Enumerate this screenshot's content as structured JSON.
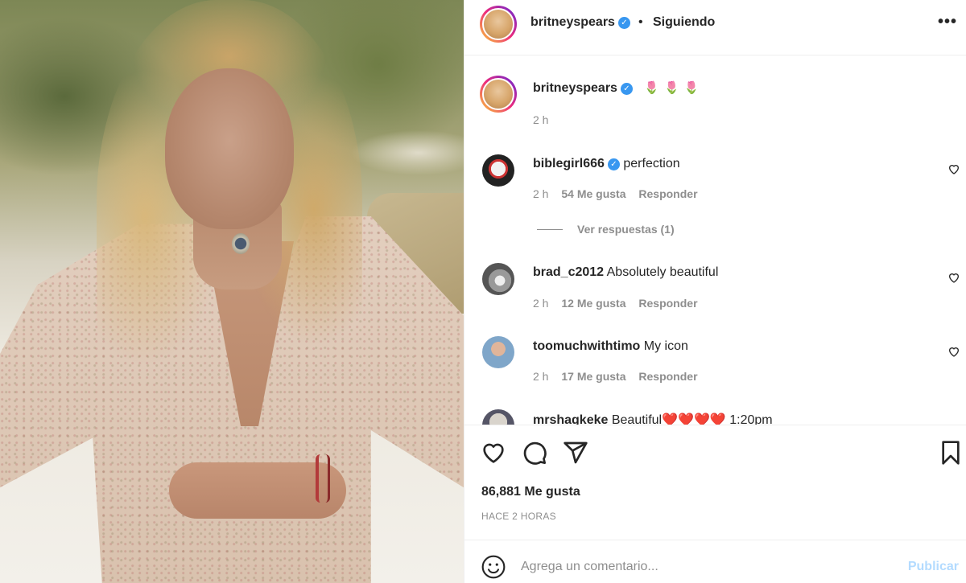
{
  "post": {
    "author": "britneyspears",
    "follow_status": "Siguiendo",
    "separator": "•",
    "more_icon": "more-options-icon",
    "caption_emojis": "🌷🌷🌷",
    "caption_time": "2 h",
    "likes": "86,881 Me gusta",
    "posted_ago": "HACE 2 HORAS"
  },
  "comments": [
    {
      "user": "biblegirl666",
      "verified": true,
      "text": "perfection",
      "time": "2 h",
      "likes": "54 Me gusta",
      "reply": "Responder"
    },
    {
      "user": "brad_c2012",
      "verified": false,
      "text": "Absolutely beautiful",
      "time": "2 h",
      "likes": "12 Me gusta",
      "reply": "Responder"
    },
    {
      "user": "toomuchwithtimo",
      "verified": false,
      "text": "My icon",
      "time": "2 h",
      "likes": "17 Me gusta",
      "reply": "Responder"
    },
    {
      "user": "mrshagkeke",
      "verified": false,
      "text": "Beautiful❤️❤️❤️❤️ 1:20pm"
    }
  ],
  "view_replies": "Ver respuestas (1)",
  "add_comment": {
    "placeholder": "Agrega un comentario...",
    "publish_label": "Publicar"
  },
  "colors": {
    "verified": "#3897f0",
    "muted_text": "#8e8e8e",
    "publish_disabled": "#b3dbff"
  }
}
